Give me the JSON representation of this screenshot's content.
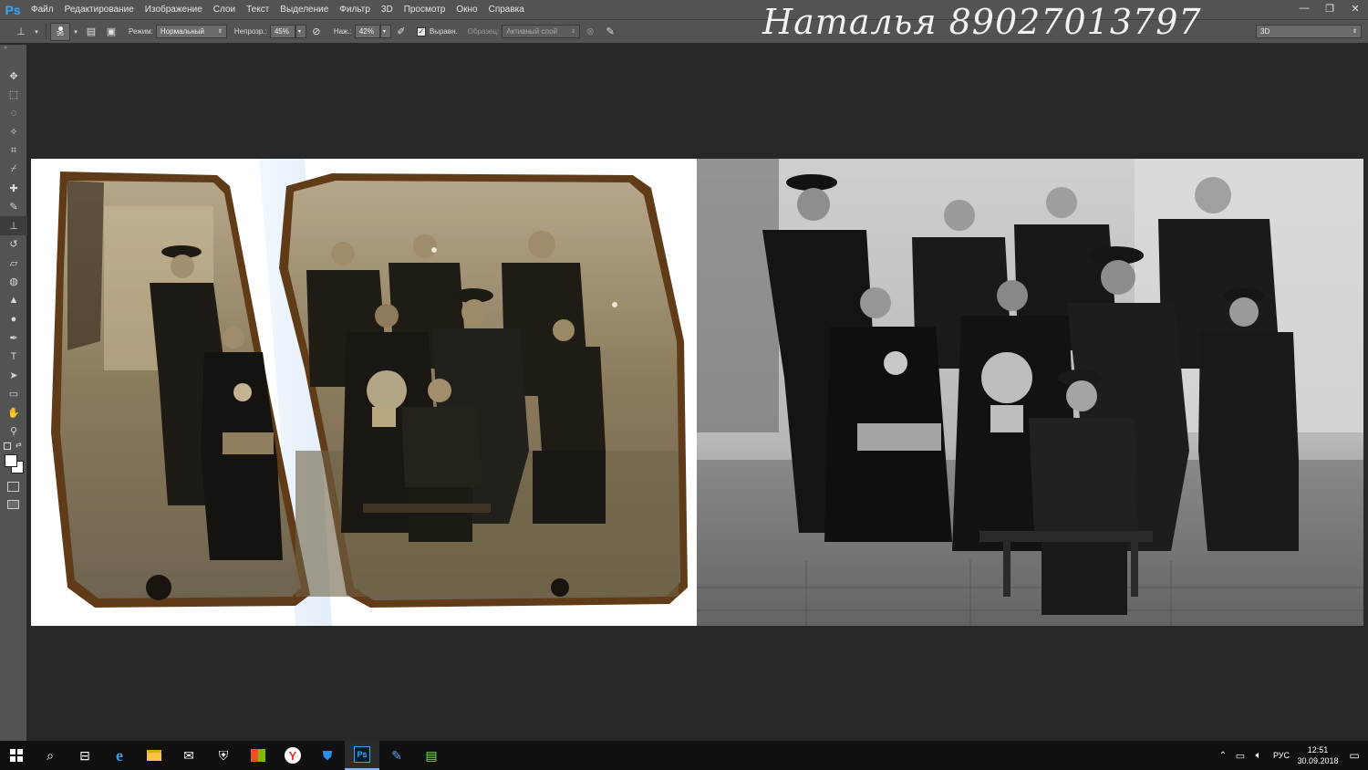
{
  "app": {
    "logo": "Ps"
  },
  "menu": [
    "Файл",
    "Редактирование",
    "Изображение",
    "Слои",
    "Текст",
    "Выделение",
    "Фильтр",
    "3D",
    "Просмотр",
    "Окно",
    "Справка"
  ],
  "window_controls": {
    "minimize": "—",
    "restore": "❐",
    "close": "✕"
  },
  "options": {
    "brush_size": "96",
    "mode_label": "Режим:",
    "mode_value": "Нормальный",
    "opacity_label": "Непрозр.:",
    "opacity_value": "45%",
    "flow_label": "Наж.:",
    "flow_value": "42%",
    "aligned_label": "Выравн.",
    "sample_label": "Образец:",
    "sample_value": "Активный слой",
    "workspace": "3D"
  },
  "watermark": "Наталья 89027013797",
  "tools": [
    "move-icon",
    "marquee-icon",
    "lasso-icon",
    "magic-wand-icon",
    "crop-icon",
    "eyedropper-icon",
    "healing-icon",
    "brush-icon",
    "clone-stamp-icon",
    "history-brush-icon",
    "eraser-icon",
    "paint-bucket-icon",
    "blur-icon",
    "dodge-icon",
    "pen-icon",
    "type-icon",
    "path-select-icon",
    "shape-icon",
    "hand-icon",
    "zoom-icon"
  ],
  "colors": {
    "menubar": "#535353",
    "background": "#282828",
    "taskbar": "#101010",
    "ps_blue": "#31a8ff"
  },
  "taskbar": {
    "icons": [
      "windows-start-icon",
      "search-icon",
      "task-view-icon",
      "edge-icon",
      "file-explorer-icon",
      "mail-icon",
      "defender-icon",
      "store-icon",
      "yandex-browser-icon",
      "security-shield-icon",
      "photoshop-icon",
      "paint-icon",
      "notepad-icon"
    ],
    "language": "РУС",
    "time": "12:51",
    "date": "30.09.2018"
  }
}
